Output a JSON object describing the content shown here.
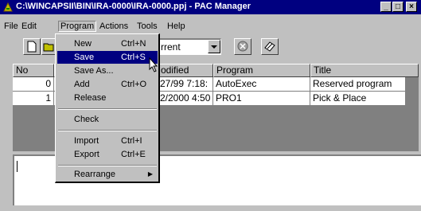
{
  "window": {
    "title": "C:\\WINCAPSII\\BIN\\IRA-0000\\IRA-0000.ppj - PAC Manager",
    "minimize": "_",
    "maximize": "□",
    "close": "×"
  },
  "menubar": [
    "File",
    "Edit",
    "Program",
    "Actions",
    "Tools",
    "Help"
  ],
  "toolbar": {
    "combo_value": "rrent"
  },
  "table": {
    "columns": [
      "No",
      "odified",
      "Program",
      "Title"
    ],
    "rows": [
      {
        "no": "0",
        "modified": "27/99 7:18:",
        "program": "AutoExec",
        "title": "Reserved program"
      },
      {
        "no": "1",
        "modified": "2/2000 4:50",
        "program": "PRO1",
        "title": "Pick & Place"
      }
    ]
  },
  "program_menu": {
    "items": [
      {
        "label": "New",
        "shortcut": "Ctrl+N"
      },
      {
        "label": "Save",
        "shortcut": "Ctrl+S",
        "highlighted": true
      },
      {
        "label": "Save As...",
        "shortcut": ""
      },
      {
        "label": "Add",
        "shortcut": "Ctrl+O"
      },
      {
        "label": "Release",
        "shortcut": ""
      },
      {
        "label": "Check",
        "shortcut": ""
      },
      {
        "label": "Import",
        "shortcut": "Ctrl+I"
      },
      {
        "label": "Export",
        "shortcut": "Ctrl+E"
      },
      {
        "label": "Rearrange",
        "shortcut": "",
        "submenu": true
      }
    ],
    "submenu_arrow": "▶"
  },
  "colors": {
    "titlebar": "#000080",
    "highlight": "#000080",
    "face": "#c0c0c0"
  }
}
